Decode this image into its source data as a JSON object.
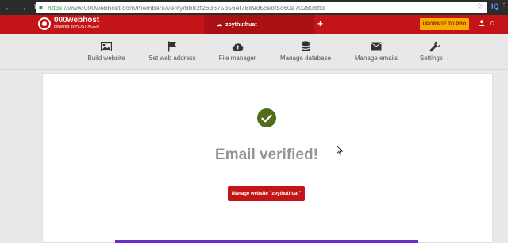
{
  "browser": {
    "url_secure": "https://",
    "url_rest": "www.000webhost.com/members/verify/bb82f263675b56ef7889d5cebf5c60a70280bff3",
    "ext_label": "IQ"
  },
  "topbar": {
    "logo_title": "000webhost",
    "logo_sub": "powered by HOSTINGER",
    "site_name": "zoythuthuat",
    "plus": "+",
    "upgrade_label": "UPGRADE TO PRO",
    "user_name": "C."
  },
  "menu": {
    "items": [
      {
        "label": "Build website",
        "icon": "image-icon"
      },
      {
        "label": "Set web address",
        "icon": "flag-icon"
      },
      {
        "label": "File manager",
        "icon": "cloud-upload-icon"
      },
      {
        "label": "Manage database",
        "icon": "database-icon"
      },
      {
        "label": "Manage emails",
        "icon": "envelope-icon"
      },
      {
        "label": "Settings",
        "icon": "wrench-icon"
      }
    ],
    "settings_caret": "⌄"
  },
  "main": {
    "title": "Email verified!",
    "button_label": "Manage website \"zoythuthuat\""
  },
  "colors": {
    "brand_red": "#c31417",
    "upgrade_yellow": "#f7ad00",
    "check_green": "#4f6d1d",
    "strip_purple": "#6a2cc9"
  }
}
